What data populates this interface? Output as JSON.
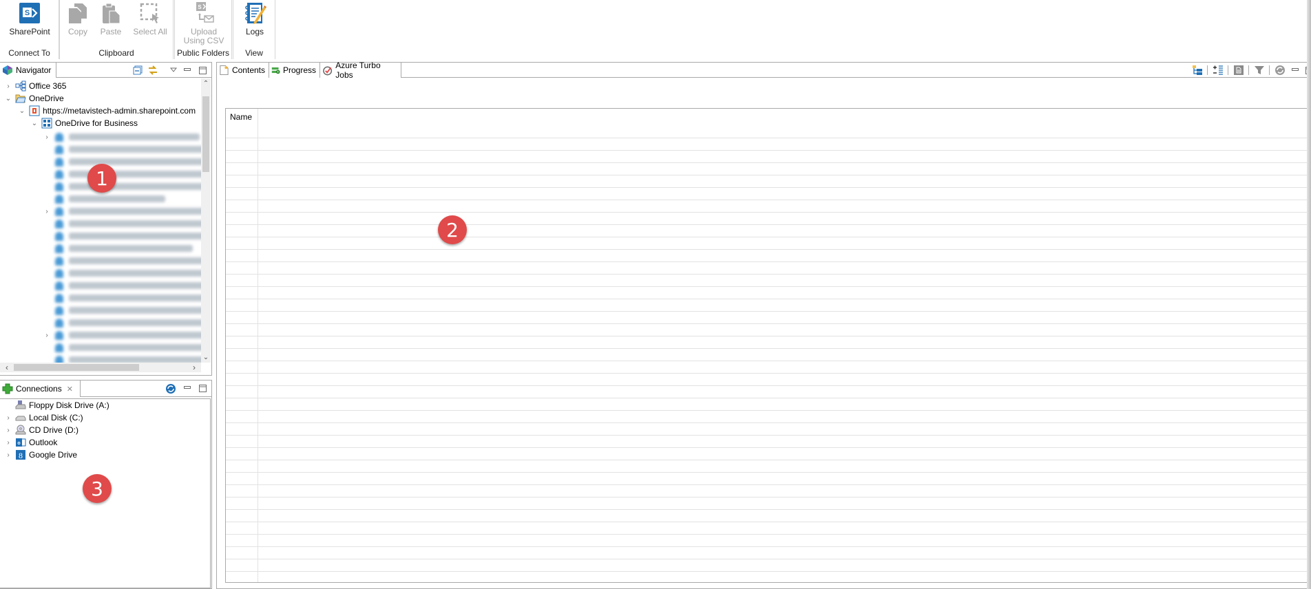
{
  "ribbon": {
    "groups": [
      {
        "label": "Connect To",
        "buttons": [
          {
            "label": "SharePoint",
            "icon": "sharepoint-icon",
            "enabled": true
          }
        ]
      },
      {
        "label": "Clipboard",
        "buttons": [
          {
            "label": "Copy",
            "icon": "copy-icon",
            "enabled": false
          },
          {
            "label": "Paste",
            "icon": "paste-icon",
            "enabled": false
          },
          {
            "label": "Select All",
            "icon": "select-all-icon",
            "enabled": false
          }
        ]
      },
      {
        "label": "Public Folders",
        "buttons": [
          {
            "label_line1": "Upload",
            "label_line2": "Using CSV",
            "icon": "upload-csv-icon",
            "enabled": false
          }
        ]
      },
      {
        "label": "View",
        "buttons": [
          {
            "label": "Logs",
            "icon": "logs-icon",
            "enabled": true
          }
        ]
      }
    ]
  },
  "navigator": {
    "title": "Navigator",
    "tree": [
      {
        "label": "Office 365",
        "expanded": false,
        "icon": "office365-icon"
      },
      {
        "label": "OneDrive",
        "expanded": true,
        "icon": "folder-open-icon"
      },
      {
        "label": "https://metavistech-admin.sharepoint.com",
        "expanded": true,
        "icon": "office-icon"
      },
      {
        "label": "OneDrive for Business",
        "expanded": true,
        "icon": "grid-icon"
      }
    ],
    "blurred_user_rows": 19,
    "blurred_rows_with_expander": [
      0,
      6,
      16
    ]
  },
  "connections": {
    "title": "Connections",
    "items": [
      {
        "label": "Floppy Disk Drive (A:)",
        "icon": "floppy-drive-icon",
        "expandable": false
      },
      {
        "label": "Local Disk (C:)",
        "icon": "local-disk-icon",
        "expandable": true
      },
      {
        "label": "CD Drive (D:)",
        "icon": "cd-drive-icon",
        "expandable": true
      },
      {
        "label": "Outlook",
        "icon": "outlook-icon",
        "expandable": true
      },
      {
        "label": "Google Drive",
        "icon": "google-drive-icon",
        "expandable": true
      }
    ]
  },
  "main": {
    "tabs": [
      {
        "label": "Contents",
        "icon": "contents-icon",
        "active": true
      },
      {
        "label": "Progress",
        "icon": "progress-icon",
        "active": false
      },
      {
        "label": "Azure Turbo Jobs",
        "icon": "azure-jobs-icon",
        "active": false
      }
    ],
    "table": {
      "columns": [
        "Name"
      ],
      "rows": []
    }
  },
  "annotations": {
    "badge1": "1",
    "badge2": "2",
    "badge3": "3"
  },
  "colors": {
    "accent": "#1f6fb5",
    "badge": "#e04a4a",
    "disabled": "#a0a0a0"
  }
}
